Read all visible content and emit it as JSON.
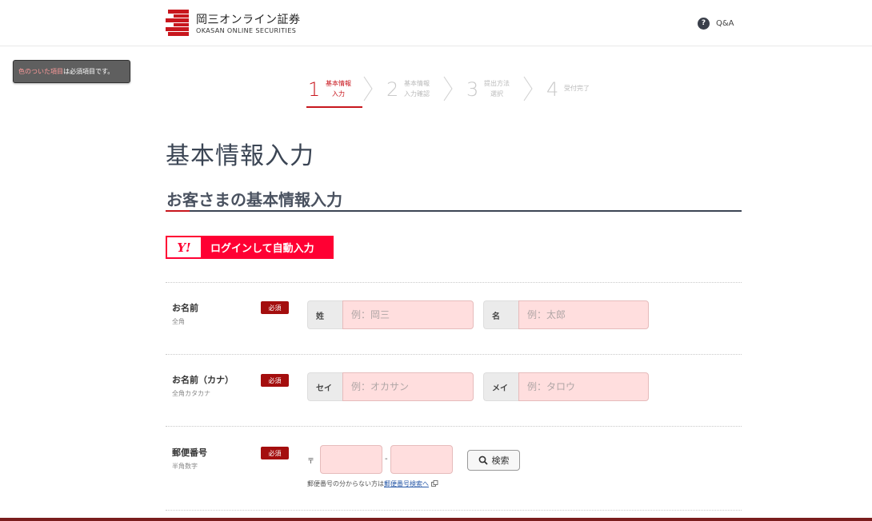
{
  "header": {
    "logo_jp": "岡三オンライン証券",
    "logo_en": "OKASAN ONLINE SECURITIES",
    "qa_icon": "?",
    "qa_label": "Q&A"
  },
  "required_note": {
    "highlight": "色のついた項目",
    "rest": "は必須項目です。"
  },
  "steps": [
    {
      "num": "1",
      "label": "基本情報\n入力",
      "active": true
    },
    {
      "num": "2",
      "label": "基本情報\n入力確認",
      "active": false
    },
    {
      "num": "3",
      "label": "提出方法\n選択",
      "active": false
    },
    {
      "num": "4",
      "label": "受付完了",
      "active": false
    }
  ],
  "page_title": "基本情報入力",
  "section_title": "お客さまの基本情報入力",
  "yahoo": {
    "mark": "Y!",
    "label": "ログインして自動入力"
  },
  "form": {
    "name": {
      "label": "お名前",
      "sub": "全角",
      "badge": "必須",
      "last_prefix": "姓",
      "last_placeholder": "例：岡三",
      "first_prefix": "名",
      "first_placeholder": "例：太郎"
    },
    "kana": {
      "label": "お名前（カナ）",
      "sub": "全角カタカナ",
      "badge": "必須",
      "last_prefix": "セイ",
      "last_placeholder": "例：オカサン",
      "first_prefix": "メイ",
      "first_placeholder": "例：タロウ"
    },
    "zip": {
      "label": "郵便番号",
      "sub": "半角数字",
      "badge": "必須",
      "mark": "〒",
      "dash": "-",
      "search_label": "検索",
      "help_text": "郵便番号の分からない方は",
      "help_link": "郵便番号検索へ"
    }
  },
  "colors": {
    "brand_red": "#c8161d",
    "yahoo_red": "#ff0033",
    "required_field_bg": "#ffdede",
    "badge_red": "#a40e0e"
  },
  "icons": {
    "qa": "question-circle-icon",
    "search": "magnifier-icon",
    "external": "external-window-icon",
    "logo": "okasan-stripes-logo"
  }
}
